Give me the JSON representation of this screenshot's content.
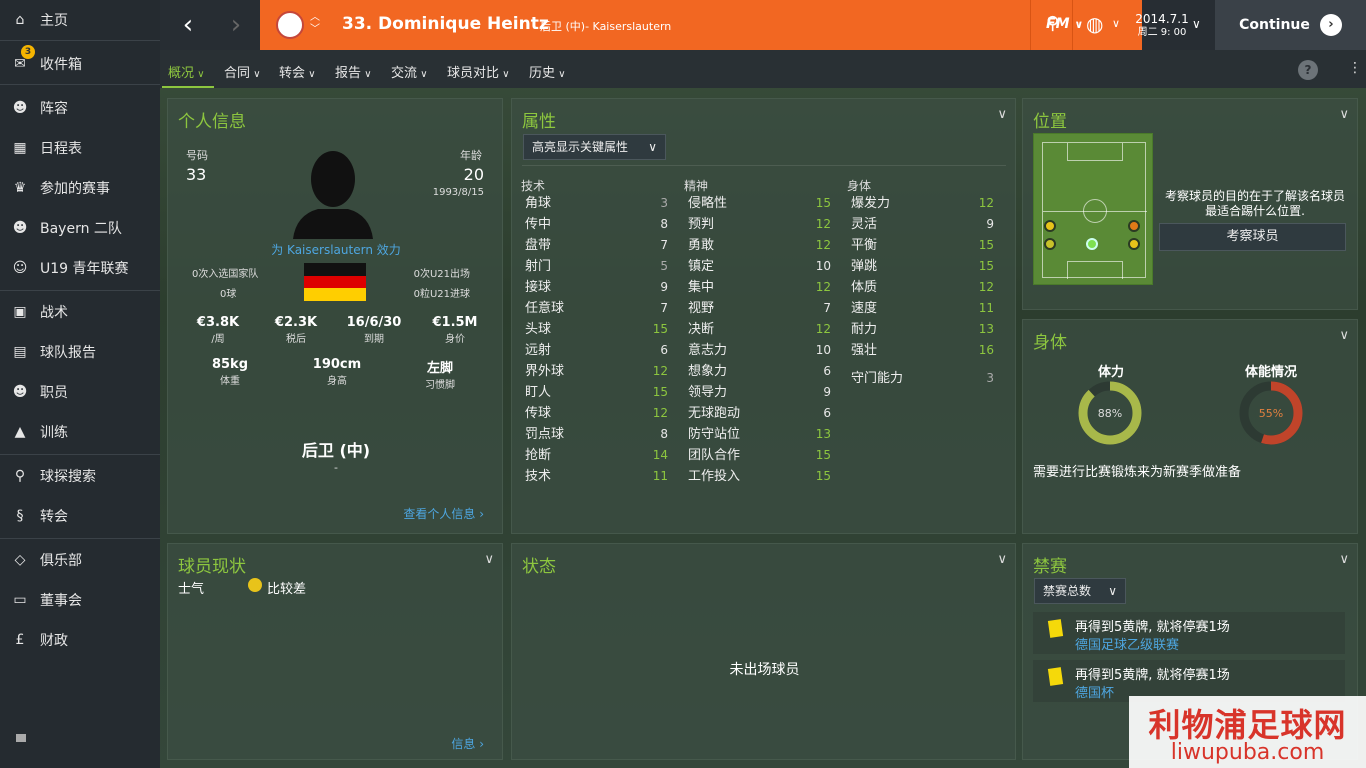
{
  "sidebar": {
    "items": [
      {
        "label": "主页",
        "icon": "home-icon",
        "glyph": "⌂"
      },
      {
        "label": "收件箱",
        "icon": "inbox-icon",
        "glyph": "✉",
        "badge": "3"
      },
      {
        "label": "阵容",
        "icon": "squad-icon",
        "glyph": "☻"
      },
      {
        "label": "日程表",
        "icon": "calendar-icon",
        "glyph": "▦"
      },
      {
        "label": "参加的赛事",
        "icon": "trophy-icon",
        "glyph": "♛"
      },
      {
        "label": "Bayern 二队",
        "icon": "team-icon",
        "glyph": "☻"
      },
      {
        "label": "U19 青年联赛",
        "icon": "youth-icon",
        "glyph": "☺"
      },
      {
        "label": "战术",
        "icon": "tactics-icon",
        "glyph": "▣"
      },
      {
        "label": "球队报告",
        "icon": "report-icon",
        "glyph": "▤"
      },
      {
        "label": "职员",
        "icon": "staff-icon",
        "glyph": "☻"
      },
      {
        "label": "训练",
        "icon": "training-icon",
        "glyph": "▲"
      },
      {
        "label": "球探搜索",
        "icon": "scout-search-icon",
        "glyph": "⚲"
      },
      {
        "label": "转会",
        "icon": "transfer-icon",
        "glyph": "§"
      },
      {
        "label": "俱乐部",
        "icon": "club-icon",
        "glyph": "◇"
      },
      {
        "label": "董事会",
        "icon": "board-icon",
        "glyph": "▭"
      },
      {
        "label": "财政",
        "icon": "finance-icon",
        "glyph": "£"
      }
    ]
  },
  "topbar": {
    "title": "33. Dominique Heintz",
    "subtitle": "后卫 (中)- Kaiserslautern",
    "fm": "FM",
    "date": "2014.7.1",
    "time": "周二 9: 00",
    "continue": "Continue"
  },
  "tabs": [
    "概况",
    "合同",
    "转会",
    "报告",
    "交流",
    "球员对比",
    "历史"
  ],
  "info": {
    "title": "个人信息",
    "num_label": "号码",
    "num": "33",
    "age_label": "年龄",
    "age": "20",
    "dob": "1993/8/15",
    "plays_for": "为 Kaiserslautern 效力",
    "caps": "0次入选国家队",
    "goals": "0球",
    "u21caps": "0次U21出场",
    "u21goals": "0粒U21进球",
    "wage": "€3.8K",
    "wage_l": "/周",
    "after_tax": "€2.3K",
    "after_tax_l": "税后",
    "expiry": "16/6/30",
    "expiry_l": "到期",
    "value": "€1.5M",
    "value_l": "身价",
    "weight": "85kg",
    "weight_l": "体重",
    "height": "190cm",
    "height_l": "身高",
    "foot": "左脚",
    "foot_l": "习惯脚",
    "position": "后卫 (中)",
    "dash": "-",
    "link": "查看个人信息 ›"
  },
  "attributes": {
    "title": "属性",
    "dropdown": "高亮显示关键属性",
    "technical": {
      "head": "技术",
      "rows": [
        [
          "角球",
          "3"
        ],
        [
          "传中",
          "8"
        ],
        [
          "盘带",
          "7"
        ],
        [
          "射门",
          "5"
        ],
        [
          "接球",
          "9"
        ],
        [
          "任意球",
          "7"
        ],
        [
          "头球",
          "15"
        ],
        [
          "远射",
          "6"
        ],
        [
          "界外球",
          "12"
        ],
        [
          "盯人",
          "15"
        ],
        [
          "传球",
          "12"
        ],
        [
          "罚点球",
          "8"
        ],
        [
          "抢断",
          "14"
        ],
        [
          "技术",
          "11"
        ]
      ]
    },
    "mental": {
      "head": "精神",
      "rows": [
        [
          "侵略性",
          "15"
        ],
        [
          "预判",
          "12"
        ],
        [
          "勇敢",
          "12"
        ],
        [
          "镇定",
          "10"
        ],
        [
          "集中",
          "12"
        ],
        [
          "视野",
          "7"
        ],
        [
          "决断",
          "12"
        ],
        [
          "意志力",
          "10"
        ],
        [
          "想象力",
          "6"
        ],
        [
          "领导力",
          "9"
        ],
        [
          "无球跑动",
          "6"
        ],
        [
          "防守站位",
          "13"
        ],
        [
          "团队合作",
          "15"
        ],
        [
          "工作投入",
          "15"
        ]
      ]
    },
    "physical": {
      "head": "身体",
      "rows": [
        [
          "爆发力",
          "12"
        ],
        [
          "灵活",
          "9"
        ],
        [
          "平衡",
          "15"
        ],
        [
          "弹跳",
          "15"
        ],
        [
          "体质",
          "12"
        ],
        [
          "速度",
          "11"
        ],
        [
          "耐力",
          "13"
        ],
        [
          "强壮",
          "16"
        ]
      ],
      "gk": [
        "守门能力",
        "3"
      ]
    }
  },
  "position": {
    "title": "位置",
    "text1": "考察球员的目的在于了解该名球员",
    "text2": "最适合踢什么位置.",
    "button": "考察球员"
  },
  "fitness": {
    "title": "身体",
    "stamina_l": "体力",
    "stamina": 0.88,
    "stamina_t": "88%",
    "cond_l": "体能情况",
    "cond": 0.55,
    "cond_t": "55%",
    "note": "需要进行比赛锻炼来为新赛季做准备",
    "colors": {
      "stamina": "#a8b84a",
      "cond": "#c0442a",
      "track": "#2d3a33"
    }
  },
  "status": {
    "title": "球员现状",
    "morale_l": "士气",
    "morale": "比较差",
    "link": "信息 ›"
  },
  "state": {
    "title": "状态",
    "empty": "未出场球员"
  },
  "bans": {
    "title": "禁赛",
    "dropdown": "禁赛总数",
    "items": [
      {
        "text": "再得到5黄牌, 就将停赛1场",
        "comp": "德国足球乙级联赛"
      },
      {
        "text": "再得到5黄牌, 就将停赛1场",
        "comp": "德国杯"
      }
    ]
  },
  "watermark": {
    "line1": "利物浦足球网",
    "line2": "liwupuba.com"
  }
}
